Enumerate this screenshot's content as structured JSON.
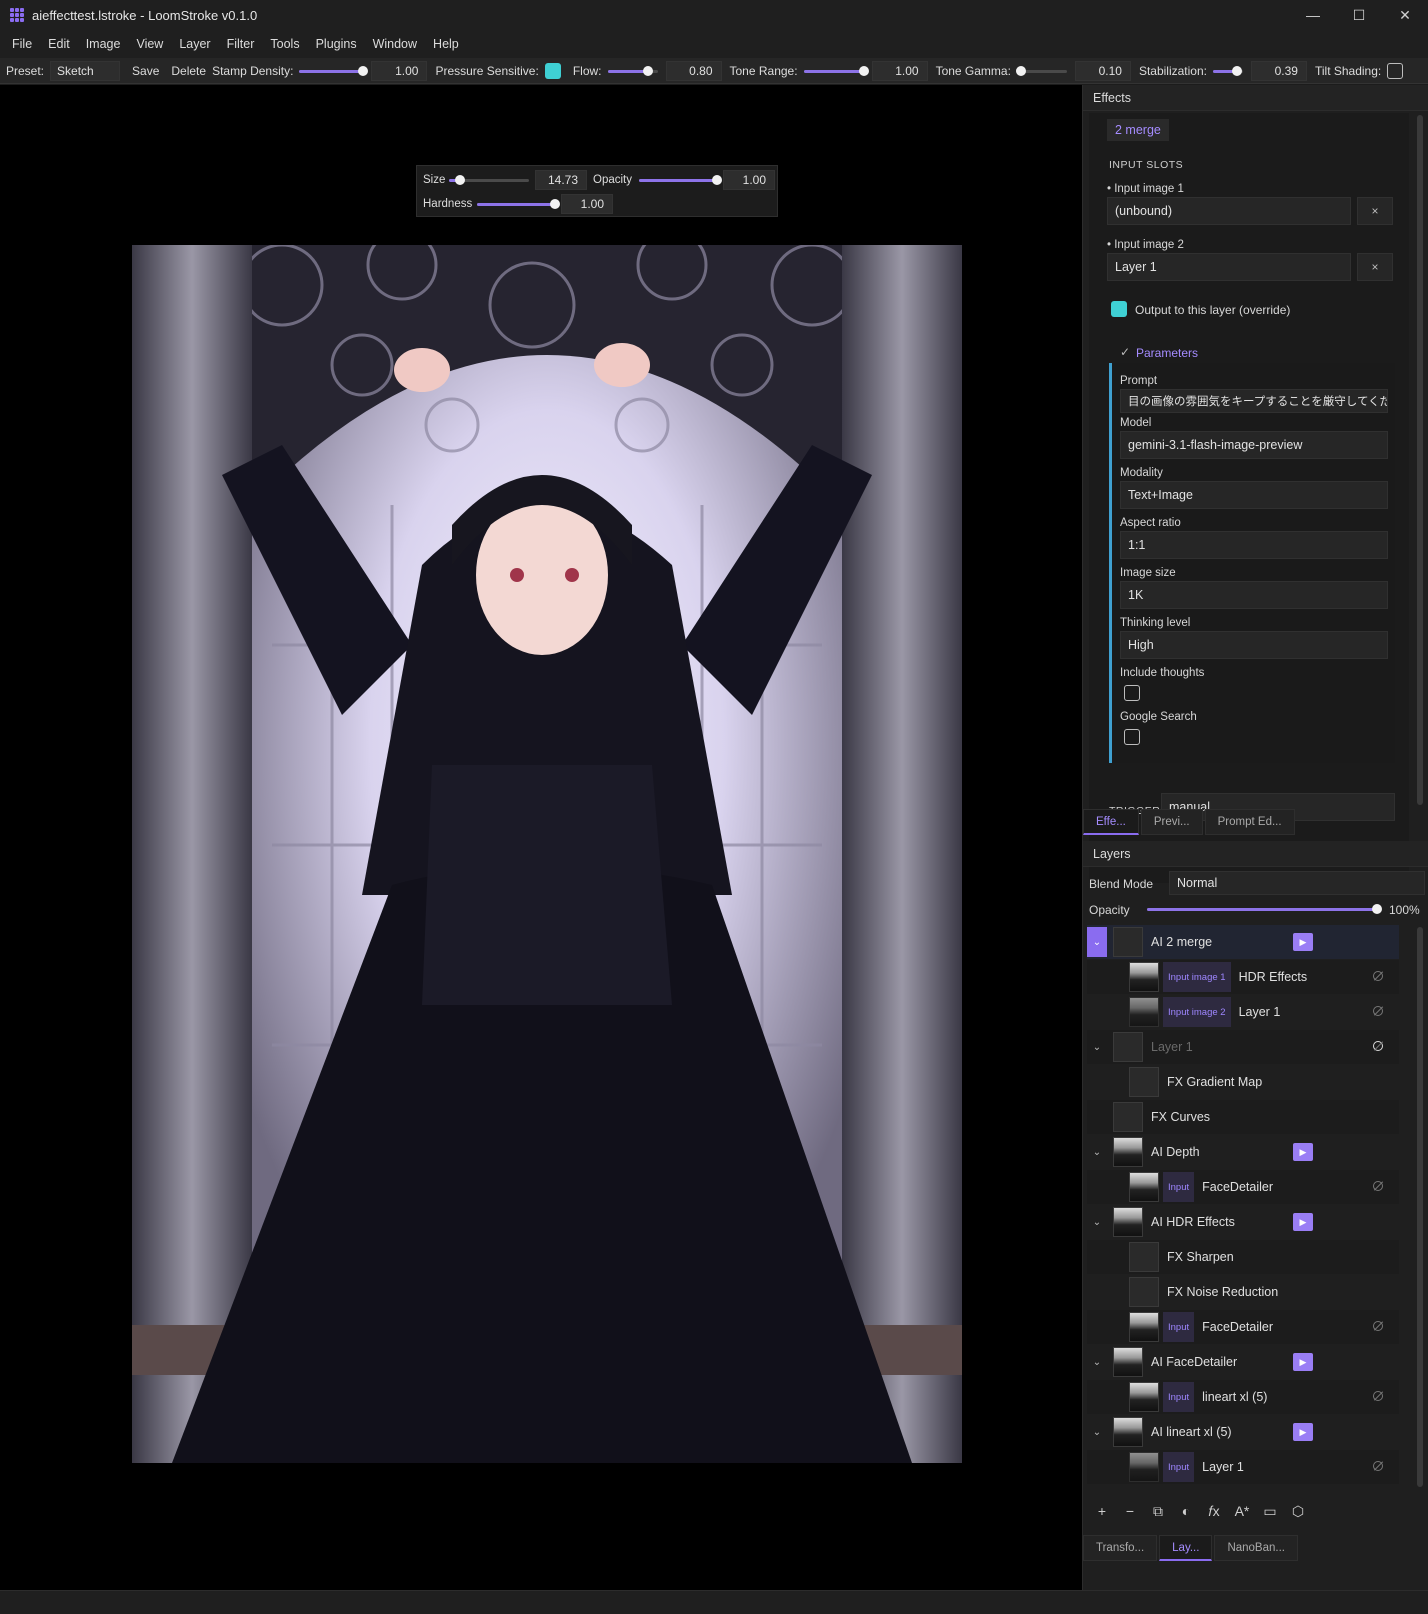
{
  "window": {
    "title": "aieffecttest.lstroke - LoomStroke v0.1.0",
    "controls": [
      "—",
      "☐",
      "✕"
    ]
  },
  "menu": [
    "File",
    "Edit",
    "Image",
    "View",
    "Layer",
    "Filter",
    "Tools",
    "Plugins",
    "Window",
    "Help"
  ],
  "toolbar": {
    "preset_label": "Preset:",
    "preset_value": "Sketch",
    "save": "Save",
    "delete": "Delete",
    "stamp_density_label": "Stamp Density:",
    "stamp_density_value": "1.00",
    "pressure_label": "Pressure Sensitive:",
    "flow_label": "Flow:",
    "flow_value": "0.80",
    "tone_range_label": "Tone Range:",
    "tone_range_value": "1.00",
    "tone_gamma_label": "Tone Gamma:",
    "tone_gamma_value": "0.10",
    "stabilization_label": "Stabilization:",
    "stabilization_value": "0.39",
    "tilt_label": "Tilt Shading:"
  },
  "brush_popup": {
    "size_label": "Size",
    "size_value": "14.73",
    "opacity_label": "Opacity",
    "opacity_value": "1.00",
    "hardness_label": "Hardness",
    "hardness_value": "1.00"
  },
  "effects": {
    "header": "Effects",
    "tab": "2 merge",
    "input_slots_label": "INPUT SLOTS",
    "input1_label": "• Input image 1",
    "input1_value": "(unbound)",
    "input2_label": "• Input image 2",
    "input2_value": "Layer 1",
    "clear": "×",
    "output_override": "Output to this layer (override)",
    "parameters_label": "Parameters",
    "prompt_label": "Prompt",
    "prompt_value": "目の画像の雰囲気をキープすることを厳守してください。",
    "model_label": "Model",
    "model_value": "gemini-3.1-flash-image-preview",
    "modality_label": "Modality",
    "modality_value": "Text+Image",
    "aspect_label": "Aspect ratio",
    "aspect_value": "1:1",
    "imgsize_label": "Image size",
    "imgsize_value": "1K",
    "thinking_label": "Thinking level",
    "thinking_value": "High",
    "include_thoughts_label": "Include thoughts",
    "google_search_label": "Google Search",
    "trigger_label": "TRIGGER",
    "trigger_value": "manual"
  },
  "dock_tabs_top": [
    "Effe...",
    "Previ...",
    "Prompt Ed..."
  ],
  "layers": {
    "header": "Layers",
    "blend_label": "Blend Mode",
    "blend_value": "Normal",
    "opacity_label": "Opacity",
    "opacity_value": "100%",
    "rows": [
      {
        "name": "AI  2 merge"
      },
      {
        "tag": "Input image 1",
        "name": "HDR Effects"
      },
      {
        "tag": "Input image 2",
        "name": "Layer 1"
      },
      {
        "name": "Layer 1"
      },
      {
        "name": "FX  Gradient Map"
      },
      {
        "name": "FX  Curves"
      },
      {
        "name": "AI  Depth"
      },
      {
        "tag": "Input",
        "name": "FaceDetailer"
      },
      {
        "name": "AI  HDR Effects"
      },
      {
        "name": "FX  Sharpen"
      },
      {
        "name": "FX  Noise Reduction"
      },
      {
        "tag": "Input",
        "name": "FaceDetailer"
      },
      {
        "name": "AI  FaceDetailer"
      },
      {
        "tag": "Input",
        "name": "lineart xl (5)"
      },
      {
        "name": "AI  lineart xl (5)"
      },
      {
        "tag": "Input",
        "name": "Layer 1"
      }
    ]
  },
  "dock_tabs_bottom": [
    "Transfo...",
    "Lay...",
    "NanoBan..."
  ],
  "bottom_icons": [
    "+",
    "−",
    "⧉",
    "◐",
    "𝑓x",
    "A*",
    "▭",
    "⬡"
  ],
  "colors": {
    "accent": "#8a6cf0",
    "teal": "#3fd0d4",
    "param_bar": "#3fa0d0"
  }
}
